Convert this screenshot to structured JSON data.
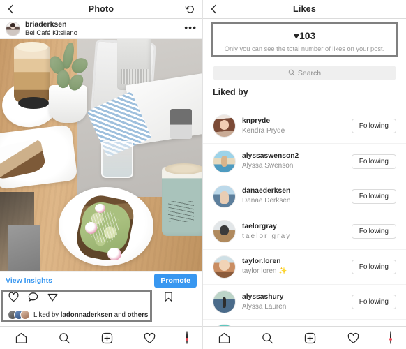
{
  "left_panel": {
    "header": {
      "title": "Photo",
      "back_icon": "chevron-left-icon",
      "refresh_icon": "refresh-history-icon"
    },
    "post": {
      "username": "briaderksen",
      "location": "Bel Café Kitsilano",
      "menu_icon": "more-options-icon",
      "avatar_icon": "user-avatar"
    },
    "photo_alt": "Café table with latte, succulent plant, pastry, water glass and avocado toast",
    "insights": {
      "link_label": "View Insights",
      "promote_label": "Promote"
    },
    "actions": {
      "like_icon": "heart-icon",
      "comment_icon": "comment-icon",
      "share_icon": "share-icon",
      "save_icon": "bookmark-icon"
    },
    "liked_by": {
      "prefix": "Liked by ",
      "username": "ladonnaderksen",
      "middle": " and ",
      "suffix": "others"
    }
  },
  "right_panel": {
    "header": {
      "title": "Likes",
      "back_icon": "chevron-left-icon"
    },
    "likes_box": {
      "heart_icon": "heart-filled-icon",
      "count": "103",
      "note": "Only you can see the total number of likes on your post."
    },
    "search": {
      "placeholder": "Search",
      "icon": "search-icon"
    },
    "list_heading": "Liked by",
    "users": [
      {
        "username": "knpryde",
        "fullname": "Kendra Pryde",
        "button": "Following",
        "avatar": "av1",
        "spaced": false
      },
      {
        "username": "alyssaswenson2",
        "fullname": "Alyssa Swenson",
        "button": "Following",
        "avatar": "av2",
        "spaced": false
      },
      {
        "username": "danaederksen",
        "fullname": "Danae Derksen",
        "button": "Following",
        "avatar": "av3",
        "spaced": false
      },
      {
        "username": "taelorgray",
        "fullname": "taelor gray",
        "button": "Following",
        "avatar": "av4",
        "spaced": true
      },
      {
        "username": "taylor.loren",
        "fullname": "taylor loren ✨",
        "button": "Following",
        "avatar": "av5",
        "spaced": false
      },
      {
        "username": "alyssashury",
        "fullname": "Alyssa Lauren",
        "button": "Following",
        "avatar": "av6",
        "spaced": false
      }
    ]
  },
  "bottom_nav": {
    "home_icon": "home-icon",
    "search_icon": "search-icon",
    "add_icon": "add-post-icon",
    "activity_icon": "heart-icon",
    "profile_icon": "profile-avatar-icon"
  },
  "colors": {
    "accent_blue": "#3897f0",
    "annotation_gray": "#808080",
    "text_primary": "#262626",
    "text_secondary": "#8e8e8e",
    "notification_red": "#ed4956"
  }
}
